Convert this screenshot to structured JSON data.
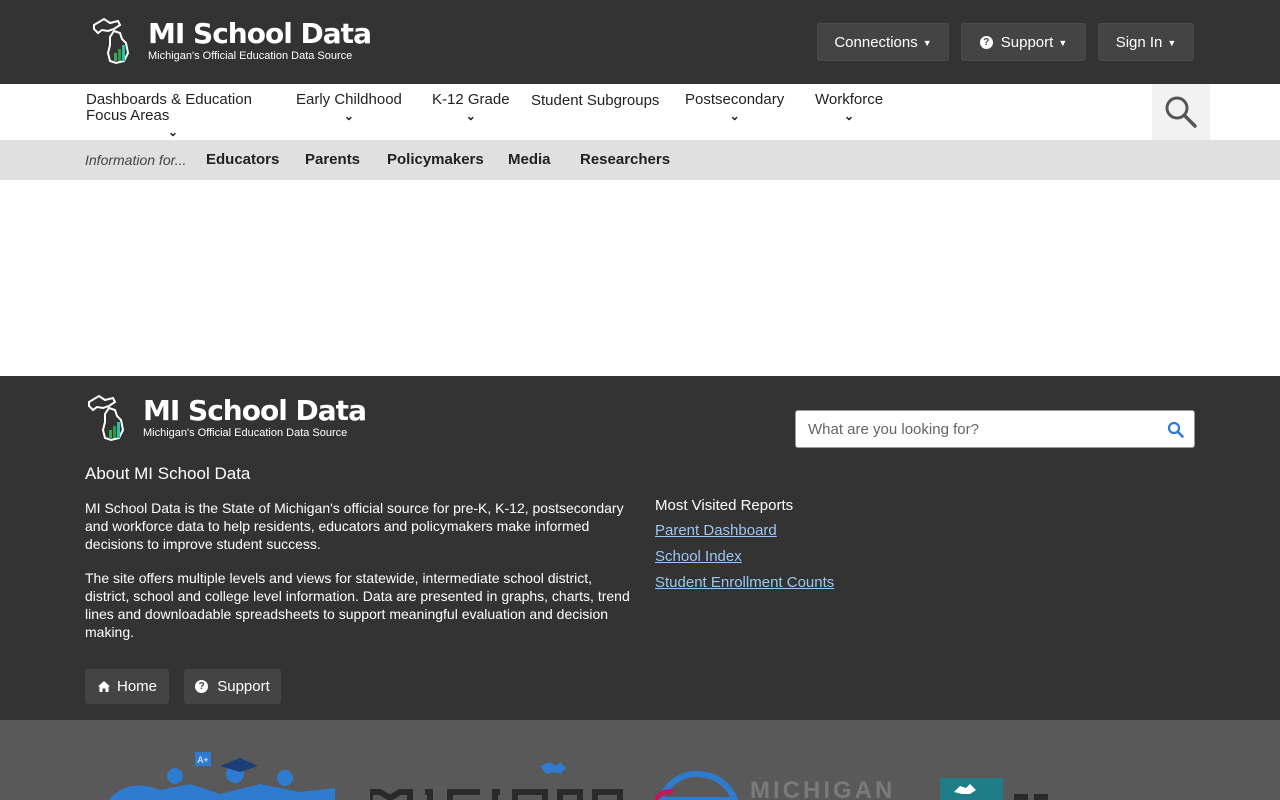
{
  "header": {
    "logo_title": "MI School Data",
    "logo_subtitle": "Michigan's Official Education Data Source",
    "connections_label": "Connections",
    "support_label": "Support",
    "signin_label": "Sign In"
  },
  "nav": {
    "items": [
      {
        "label": "Dashboards & Education Focus Areas"
      },
      {
        "label": "Early Childhood"
      },
      {
        "label": "K-12 Grade"
      },
      {
        "label": "Student Subgroups"
      },
      {
        "label": "Postsecondary"
      },
      {
        "label": "Workforce"
      }
    ]
  },
  "info_bar": {
    "label": "Information for...",
    "links": [
      "Educators",
      "Parents",
      "Policymakers",
      "Media",
      "Researchers"
    ]
  },
  "footer": {
    "logo_title": "MI School Data",
    "logo_subtitle": "Michigan's Official Education Data Source",
    "search_placeholder": "What are you looking for?",
    "about_title": "About MI School Data",
    "about_p1": "MI School Data is the State of Michigan's official source for pre-K, K-12, postsecondary and workforce data to help residents, educators and policymakers make informed decisions to improve student success.",
    "about_p2": "The site offers multiple levels and views for statewide, intermediate school district, district, school and college level information. Data are presented in graphs, charts, trend lines and downloadable spreadsheets to support meaningful evaluation and decision making.",
    "most_visited_title": "Most Visited Reports",
    "most_visited": [
      "Parent Dashboard",
      "School Index",
      "Student Enrollment Counts"
    ],
    "home_label": "Home",
    "support_label": "Support"
  },
  "colors": {
    "header_bg": "#333333",
    "infobar_bg": "#e0e0e0",
    "link_color": "#9ec6f2",
    "accent_green": "#2e9b4a",
    "partner_blue": "#2f7bd0",
    "partner_teal": "#1e7d86"
  }
}
